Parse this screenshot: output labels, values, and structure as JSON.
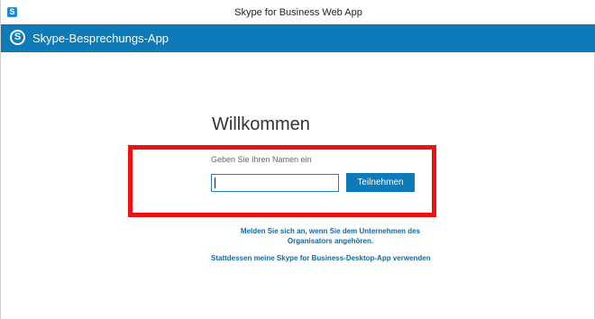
{
  "window": {
    "title": "Skype for Business Web App",
    "icon": "skype-icon"
  },
  "appbar": {
    "title": "Skype-Besprechungs-App",
    "logo_icon": "skype-logo-icon",
    "color": "#0f7ab8"
  },
  "main": {
    "welcome": "Willkommen",
    "name_label": "Geben Sie Ihren Namen ein",
    "name_value": "",
    "join_label": "Teilnehmen",
    "signin_link": "Melden Sie sich an, wenn Sie dem Unternehmen des Organisators angehören.",
    "desktop_link": "Stattdessen meine Skype for Business-Desktop-App verwenden"
  },
  "highlight": {
    "color": "#ee1111"
  }
}
